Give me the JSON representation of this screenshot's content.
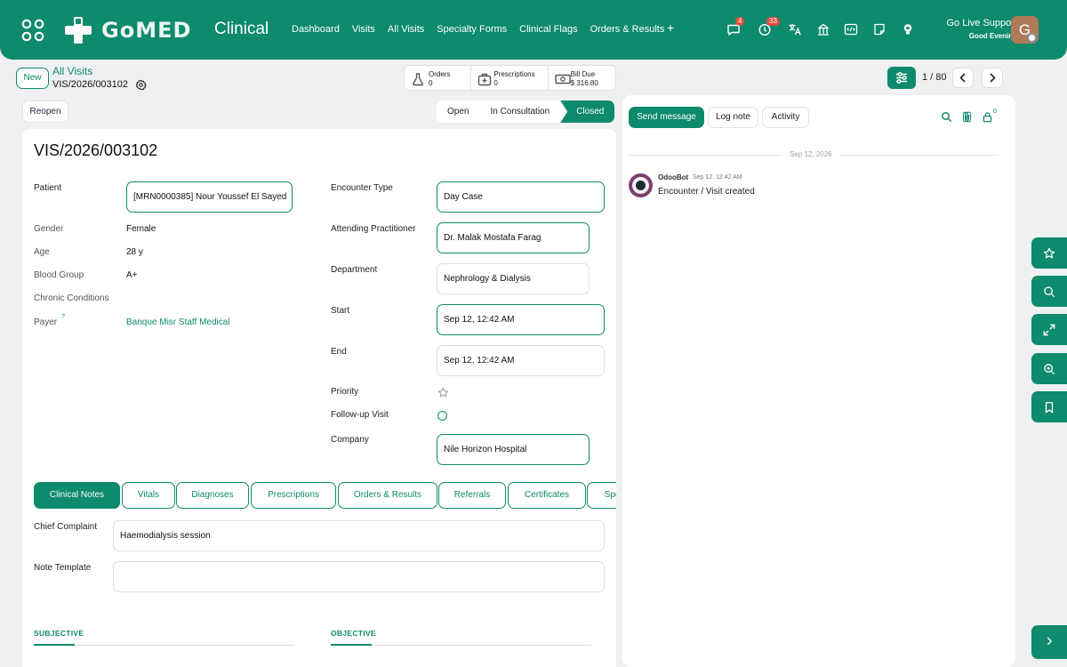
{
  "navbar": {
    "app_title": "Clinical",
    "logo_text": "GoMED",
    "menu": [
      "Dashboard",
      "Visits",
      "All Visits",
      "Specialty Forms",
      "Clinical Flags",
      "Orders & Results"
    ],
    "plus": "+",
    "messages_count": "4",
    "activities_count": "33",
    "support_name": "Go Live Support",
    "support_greeting": "Good Evening",
    "avatar_initial": "G"
  },
  "control_panel": {
    "new_label": "New",
    "breadcrumb_parent": "All Visits",
    "breadcrumb_current": "VIS/2026/003102",
    "stats": [
      {
        "label": "Orders",
        "value": "0"
      },
      {
        "label": "Prescriptions",
        "value": "0"
      },
      {
        "label": "Bill Due",
        "value": "$ 316.80"
      }
    ],
    "pager": "1 / 80"
  },
  "statusbar": {
    "reopen_label": "Reopen",
    "states": [
      "Open",
      "In Consultation",
      "Closed"
    ],
    "active_state": "Closed"
  },
  "form": {
    "title": "VIS/2026/003102",
    "left": {
      "patient_label": "Patient",
      "patient_value": "[MRN0000385] Nour Youssef El Sayed",
      "gender_label": "Gender",
      "gender_value": "Female",
      "age_label": "Age",
      "age_value": "28 y",
      "blood_label": "Blood Group",
      "blood_value": "A+",
      "chronic_label": "Chronic Conditions",
      "payer_label": "Payer",
      "payer_help": "?",
      "payer_value": "Banque Misr Staff Medical"
    },
    "right": {
      "encounter_label": "Encounter Type",
      "encounter_value": "Day Case",
      "practitioner_label": "Attending Practitioner",
      "practitioner_value": "Dr. Malak Mostafa Farag",
      "department_label": "Department",
      "department_value": "Nephrology & Dialysis",
      "start_label": "Start",
      "start_value": "Sep 12, 12:42 AM",
      "end_label": "End",
      "end_value": "Sep 12, 12:42 AM",
      "priority_label": "Priority",
      "followup_label": "Follow-up Visit",
      "company_label": "Company",
      "company_value": "Nile Horizon Hospital"
    },
    "tabs": [
      "Clinical Notes",
      "Vitals",
      "Diagnoses",
      "Prescriptions",
      "Orders & Results",
      "Referrals",
      "Certificates",
      "Specialty"
    ],
    "active_tab": "Clinical Notes",
    "notes": {
      "chief_label": "Chief Complaint",
      "chief_value": "Haemodialysis session",
      "template_label": "Note Template",
      "template_value": "",
      "subjective": "SUBJECTIVE",
      "objective": "OBJECTIVE"
    }
  },
  "chatter": {
    "send_message": "Send message",
    "log_note": "Log note",
    "activity": "Activity",
    "followers_count": "0",
    "date": "Sep 12, 2026",
    "messages": [
      {
        "author": "OdooBot",
        "time": "Sep 12, 12:42 AM",
        "body": "Encounter / Visit created"
      }
    ]
  },
  "colors": {
    "brand": "#0e8a6c",
    "badge": "#e74c3c"
  },
  "icons": [
    "apps-icon",
    "chat-icon",
    "clock-icon",
    "translate-icon",
    "bank-icon",
    "code-icon",
    "note-icon",
    "bulb-icon",
    "gear-icon",
    "flask-icon",
    "medkit-icon",
    "bill-icon",
    "filter-icon",
    "chevron-left-icon",
    "chevron-right-icon",
    "search-icon",
    "paperclip-icon",
    "follower-icon",
    "star-icon",
    "zoom-icon",
    "expand-icon",
    "bookmark-icon"
  ]
}
